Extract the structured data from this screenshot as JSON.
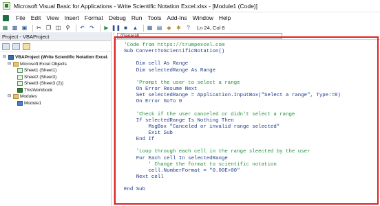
{
  "window": {
    "title": "Microsoft Visual Basic for Applications - Write Scientific Notation Excel.xlsx - [Module1 (Code)]"
  },
  "menu": [
    "File",
    "Edit",
    "View",
    "Insert",
    "Format",
    "Debug",
    "Run",
    "Tools",
    "Add-Ins",
    "Window",
    "Help"
  ],
  "toolbar": {
    "position": "Ln 24, Col 8"
  },
  "project_panel": {
    "title": "Project - VBAProject",
    "tree": [
      {
        "label": "VBAProject (Write Scientific Notation Excel.",
        "level": 0,
        "icon": "project-icon"
      },
      {
        "label": "Microsoft Excel Objects",
        "level": 1,
        "icon": "folder-icon"
      },
      {
        "label": "Sheet1 (Sheet1)",
        "level": 2,
        "icon": "sheet-icon"
      },
      {
        "label": "Sheet2 (Sheet3)",
        "level": 2,
        "icon": "sheet-icon"
      },
      {
        "label": "Sheet3 (Sheet3 (2))",
        "level": 2,
        "icon": "sheet-icon"
      },
      {
        "label": "ThisWorkbook",
        "level": 2,
        "icon": "workbook-icon"
      },
      {
        "label": "Modules",
        "level": 1,
        "icon": "folder-icon"
      },
      {
        "label": "Module1",
        "level": 2,
        "icon": "module-icon"
      }
    ]
  },
  "code_pane": {
    "object_combo": "(General)",
    "lines": [
      "'Code from https://trumpexcel.com",
      "Sub ConvertToScientificNotation()",
      "",
      "    Dim cell As Range",
      "    Dim selectedRange As Range",
      "",
      "    'Prompt the user to select a range",
      "    On Error Resume Next",
      "    Set selectedRange = Application.InputBox(\"Select a range\", Type:=8)",
      "    On Error GoTo 0",
      "",
      "    'Check if the user canceled or didn't select a range",
      "    If selectedRange Is Nothing Then",
      "        MsgBox \"Canceled or invalid range selected\"",
      "        Exit Sub",
      "    End If",
      "",
      "    'Loop through each cell in the range sleected by the user",
      "    For Each cell In selectedRange",
      "        ' Change the format to scientific notation",
      "        cell.NumberFormat = \"0.00E+00\"",
      "    Next cell",
      "",
      "End Sub"
    ]
  }
}
